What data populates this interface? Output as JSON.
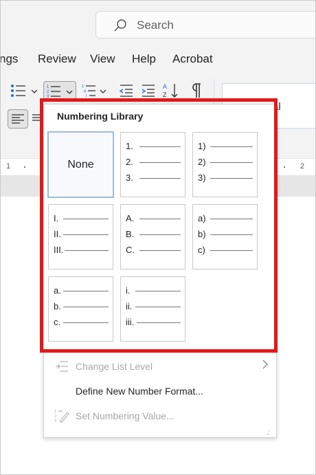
{
  "search": {
    "label": "Search"
  },
  "menubar": {
    "tabs": [
      "ngs",
      "Review",
      "View",
      "Help",
      "Acrobat"
    ]
  },
  "ribbon": {
    "style_text": "al"
  },
  "ruler": {
    "marks": [
      "1",
      "2"
    ]
  },
  "numbering_library": {
    "title": "Numbering Library",
    "none_label": "None",
    "formats": [
      {
        "markers": [
          "1.",
          "2.",
          "3."
        ]
      },
      {
        "markers": [
          "1)",
          "2)",
          "3)"
        ]
      },
      {
        "markers": [
          "I.",
          "II.",
          "III."
        ]
      },
      {
        "markers": [
          "A.",
          "B.",
          "C."
        ]
      },
      {
        "markers": [
          "a)",
          "b)",
          "c)"
        ]
      },
      {
        "markers": [
          "a.",
          "b.",
          "c."
        ]
      },
      {
        "markers": [
          "i.",
          "ii.",
          "iii."
        ]
      }
    ]
  },
  "menu_items": {
    "change_list_level": "Change List Level",
    "define_new_number_format": "Define New Number Format...",
    "set_numbering_value": "Set Numbering Value..."
  },
  "colors": {
    "highlight": "#e41818",
    "selected_border": "#9fb7d9",
    "disabled_text": "#a8a8a8"
  }
}
